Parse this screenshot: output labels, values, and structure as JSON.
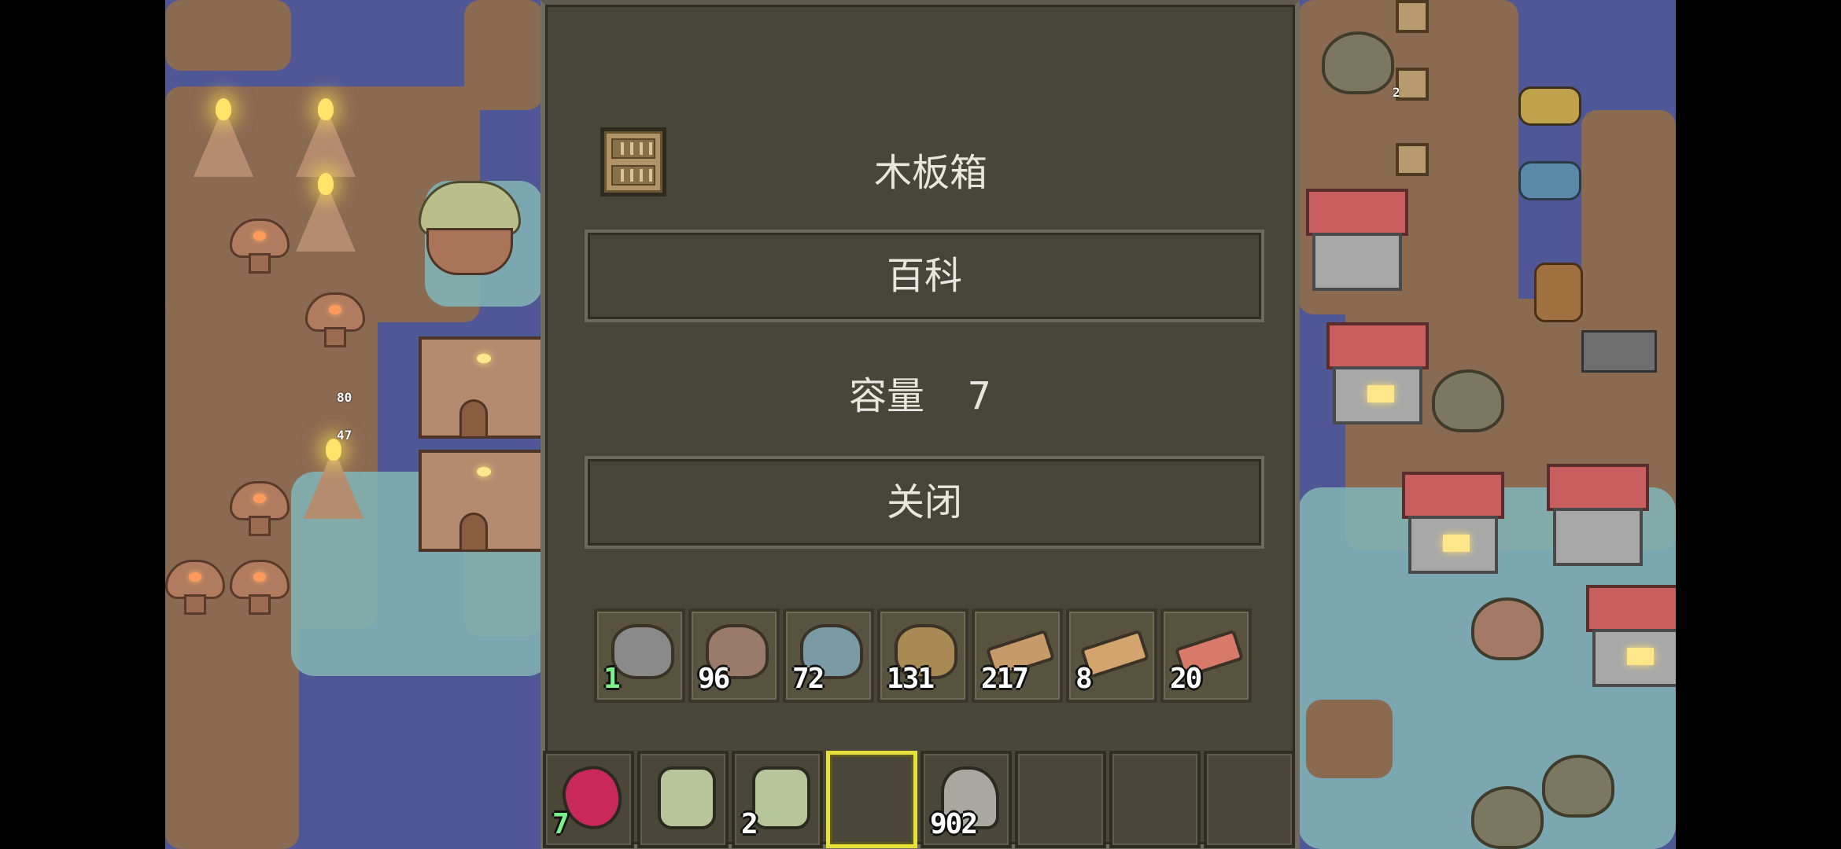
{
  "container": {
    "title": "木板箱",
    "icon": "wooden-crate-icon",
    "encyclopedia_button": "百科",
    "capacity_label": "容量",
    "capacity_value": "7",
    "close_button": "关闭"
  },
  "container_slots": [
    {
      "icon": "iron-ore-icon",
      "count": "1",
      "count_color": "green",
      "color": "#8a8a8a"
    },
    {
      "icon": "copper-ore-icon",
      "count": "96",
      "count_color": "white",
      "color": "#9a7a6a"
    },
    {
      "icon": "tin-ore-icon",
      "count": "72",
      "count_color": "white",
      "color": "#7a9aa6"
    },
    {
      "icon": "log-bundle-icon",
      "count": "131",
      "count_color": "white",
      "color": "#a98a55"
    },
    {
      "icon": "wood-plank-icon",
      "count": "217",
      "count_color": "white",
      "color": "#c79a6a"
    },
    {
      "icon": "long-plank-icon",
      "count": "8",
      "count_color": "white",
      "color": "#d4a46e"
    },
    {
      "icon": "clay-brick-icon",
      "count": "20",
      "count_color": "white",
      "color": "#d77a6a"
    }
  ],
  "hotbar": [
    {
      "icon": "berry-sack-icon",
      "count": "7",
      "count_color": "green",
      "color": "#c8285a",
      "selected": false
    },
    {
      "icon": "jar-icon",
      "count": "",
      "count_color": "white",
      "color": "#b8c49a",
      "selected": false
    },
    {
      "icon": "jar-icon",
      "count": "2",
      "count_color": "white",
      "color": "#b8c49a",
      "selected": false
    },
    {
      "icon": "",
      "count": "",
      "count_color": "white",
      "color": "",
      "selected": true
    },
    {
      "icon": "stone-icon",
      "count": "902",
      "count_color": "white",
      "color": "#a8a8a0",
      "selected": false
    },
    {
      "icon": "",
      "count": "",
      "count_color": "white",
      "color": "",
      "selected": false
    },
    {
      "icon": "",
      "count": "",
      "count_color": "white",
      "color": "",
      "selected": false
    },
    {
      "icon": "",
      "count": "",
      "count_color": "white",
      "color": "",
      "selected": false
    }
  ],
  "map_labels": {
    "sign_a": "80",
    "sign_b": "47",
    "crate_count": "2"
  }
}
